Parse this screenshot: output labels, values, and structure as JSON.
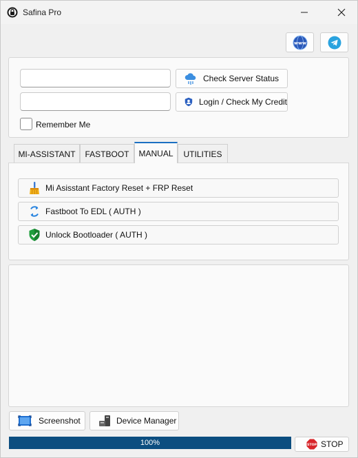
{
  "window": {
    "title": "Safina Pro",
    "controls": [
      "minimize-icon",
      "close-icon"
    ]
  },
  "top_links": [
    {
      "name": "website-button",
      "icon": "www-icon"
    },
    {
      "name": "telegram-button",
      "icon": "telegram-icon"
    }
  ],
  "login": {
    "username_value": "",
    "password_value": "",
    "check_server_label": "Check Server Status",
    "login_label": "Login / Check My Credit",
    "remember_label": "Remember Me",
    "remember_checked": false
  },
  "tabs": [
    {
      "label": "MI-ASSISTANT",
      "active": false
    },
    {
      "label": "FASTBOOT",
      "active": false
    },
    {
      "label": "MANUAL",
      "active": true
    },
    {
      "label": "UTILITIES",
      "active": false
    }
  ],
  "actions": [
    {
      "label": "Mi Asisstant Factory Reset + FRP Reset",
      "icon": "broom-icon"
    },
    {
      "label": "Fastboot To EDL ( AUTH )",
      "icon": "refresh-arrows-icon"
    },
    {
      "label": "Unlock Bootloader ( AUTH )",
      "icon": "shield-check-icon"
    }
  ],
  "log_text": "",
  "bottom": {
    "screenshot_label": "Screenshot",
    "device_manager_label": "Device Manager",
    "stop_label": "STOP"
  },
  "progress": {
    "value": 1.0,
    "text": "100%"
  },
  "colors": {
    "accent": "#0c4e80",
    "tab_active": "#1a6fc2",
    "telegram": "#2aa3df",
    "stop_red": "#d8262b"
  }
}
